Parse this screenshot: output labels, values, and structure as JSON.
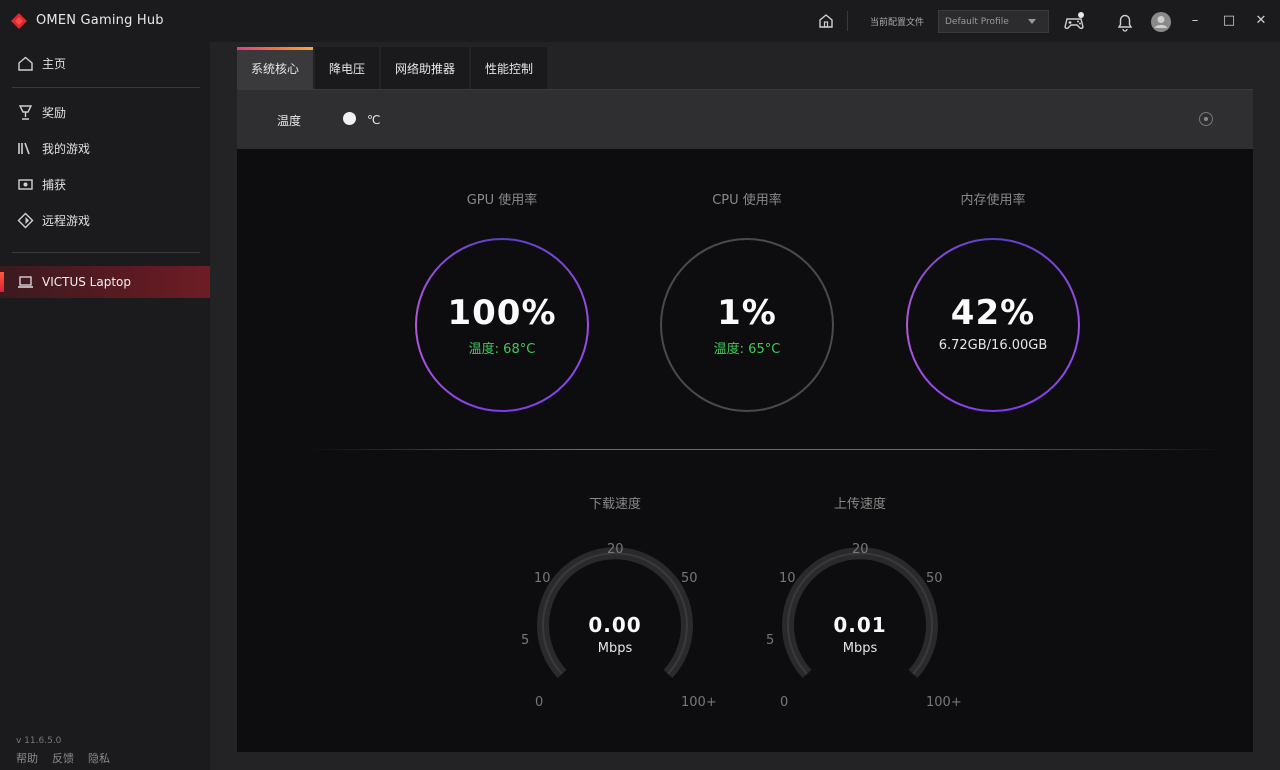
{
  "titlebar": {
    "app_title": "OMEN Gaming Hub",
    "profile_label": "当前配置文件",
    "profile_value": "Default Profile",
    "icons": [
      "home-icon",
      "gamepad-icon",
      "bell-icon",
      "avatar"
    ],
    "window_controls": {
      "minimize": "–",
      "maximize": "□",
      "close": "✕"
    }
  },
  "sidebar": {
    "items": [
      {
        "label": "主页",
        "icon": "home-icon"
      },
      {
        "label": "奖励",
        "icon": "trophy-icon"
      },
      {
        "label": "我的游戏",
        "icon": "library-icon"
      },
      {
        "label": "捕获",
        "icon": "capture-icon"
      },
      {
        "label": "远程游戏",
        "icon": "remote-play-icon"
      }
    ],
    "device": {
      "label": "VICTUS Laptop",
      "icon": "laptop-icon"
    },
    "version": "v 11.6.5.0",
    "footer": [
      "帮助",
      "反馈",
      "隐私"
    ]
  },
  "tabs": [
    {
      "label": "系统核心",
      "active": true
    },
    {
      "label": "降电压",
      "active": false
    },
    {
      "label": "网络助推器",
      "active": false
    },
    {
      "label": "性能控制",
      "active": false
    }
  ],
  "temperature": {
    "label": "温度",
    "unit": "℃",
    "toggle_on": true
  },
  "metrics": [
    {
      "title": "GPU 使用率",
      "value": "100%",
      "sub": "温度: 68°C",
      "sub_color": "green",
      "ring": "glow"
    },
    {
      "title": "CPU 使用率",
      "value": "1%",
      "sub": "温度: 65°C",
      "sub_color": "green",
      "ring": "plain"
    },
    {
      "title": "内存使用率",
      "value": "42%",
      "sub": "6.72GB/16.00GB",
      "sub_color": "white",
      "ring": "glow"
    }
  ],
  "gauges": [
    {
      "title": "下载速度",
      "value": "0.00",
      "unit": "Mbps",
      "ticks": [
        "0",
        "5",
        "10",
        "20",
        "50",
        "100+"
      ]
    },
    {
      "title": "上传速度",
      "value": "0.01",
      "unit": "Mbps",
      "ticks": [
        "0",
        "5",
        "10",
        "20",
        "50",
        "100+"
      ]
    }
  ],
  "colors": {
    "accent_red": "#d8233a",
    "ring_purple": "#7c3aed",
    "temp_green": "#3fca5a"
  }
}
